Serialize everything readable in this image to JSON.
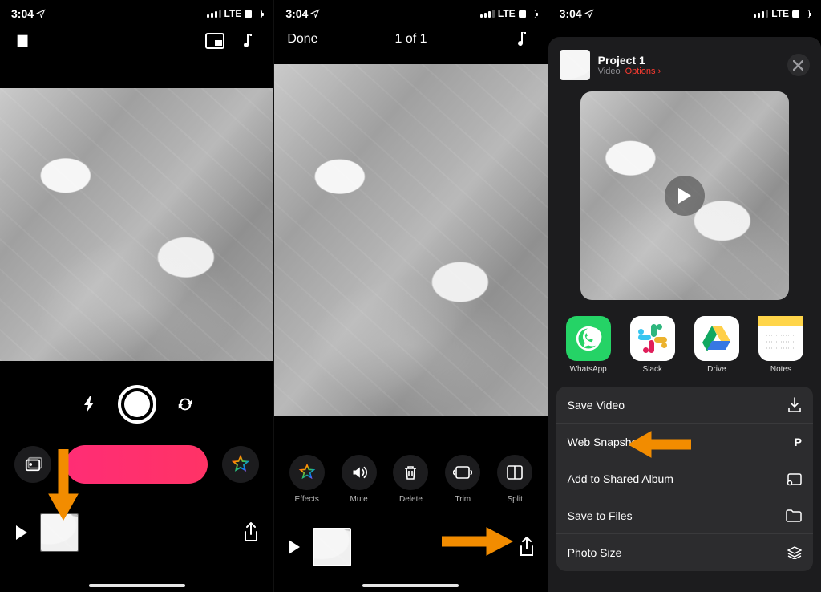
{
  "status": {
    "time": "3:04",
    "net": "LTE"
  },
  "screen1": {
    "controls": {
      "flash": "flash-icon",
      "shutter": "shutter",
      "switch": "switch-camera-icon"
    }
  },
  "screen2": {
    "done": "Done",
    "count": "1 of 1",
    "tools": [
      {
        "id": "effects",
        "label": "Effects"
      },
      {
        "id": "mute",
        "label": "Mute"
      },
      {
        "id": "delete",
        "label": "Delete"
      },
      {
        "id": "trim",
        "label": "Trim"
      },
      {
        "id": "split",
        "label": "Split"
      }
    ]
  },
  "screen3": {
    "title": "Project 1",
    "subtitle_type": "Video",
    "subtitle_options": "Options",
    "apps": [
      {
        "id": "whatsapp",
        "label": "WhatsApp"
      },
      {
        "id": "slack",
        "label": "Slack"
      },
      {
        "id": "drive",
        "label": "Drive"
      },
      {
        "id": "notes",
        "label": "Notes"
      }
    ],
    "actions": [
      {
        "id": "save-video",
        "label": "Save Video",
        "icon": "download"
      },
      {
        "id": "web-snapshot",
        "label": "Web Snapshot",
        "icon": "p"
      },
      {
        "id": "shared-album",
        "label": "Add to Shared Album",
        "icon": "album"
      },
      {
        "id": "save-files",
        "label": "Save to Files",
        "icon": "folder"
      },
      {
        "id": "photo-size",
        "label": "Photo Size",
        "icon": "layers"
      }
    ]
  }
}
